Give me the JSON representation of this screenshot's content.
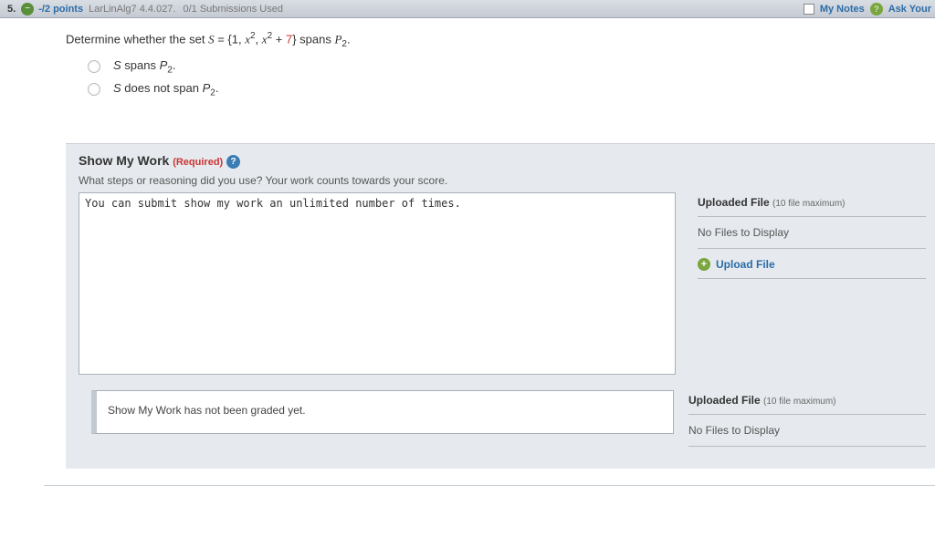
{
  "header": {
    "question_number": "5.",
    "points": "-/2 points",
    "source": "LarLinAlg7 4.4.027.",
    "submissions": "0/1 Submissions Used",
    "my_notes": "My Notes",
    "ask": "Ask Your"
  },
  "question": {
    "prompt_prefix": "Determine whether the set  ",
    "set_S": "S",
    "equals": " = {1, ",
    "x2a": "x",
    "comma": ", ",
    "x2b": "x",
    "plus7": " + ",
    "seven": "7",
    "close": "}  spans ",
    "P": "P",
    "dot": ".",
    "choices": [
      {
        "label_S": "S",
        "label_rest": " spans ",
        "label_P": "P",
        "label_dot": "."
      },
      {
        "label_S": "S",
        "label_rest": " does not span ",
        "label_P": "P",
        "label_dot": "."
      }
    ]
  },
  "smw": {
    "title": "Show My Work",
    "required": "(Required)",
    "subtext": "What steps or reasoning did you use? Your work counts towards your score.",
    "textarea_hint": "You can submit show my work an unlimited number of times.",
    "uploaded_label": "Uploaded File",
    "uploaded_max": "(10 file maximum)",
    "no_files": "No Files to Display",
    "upload_file": "Upload File",
    "not_graded": "Show My Work has not been graded yet."
  }
}
